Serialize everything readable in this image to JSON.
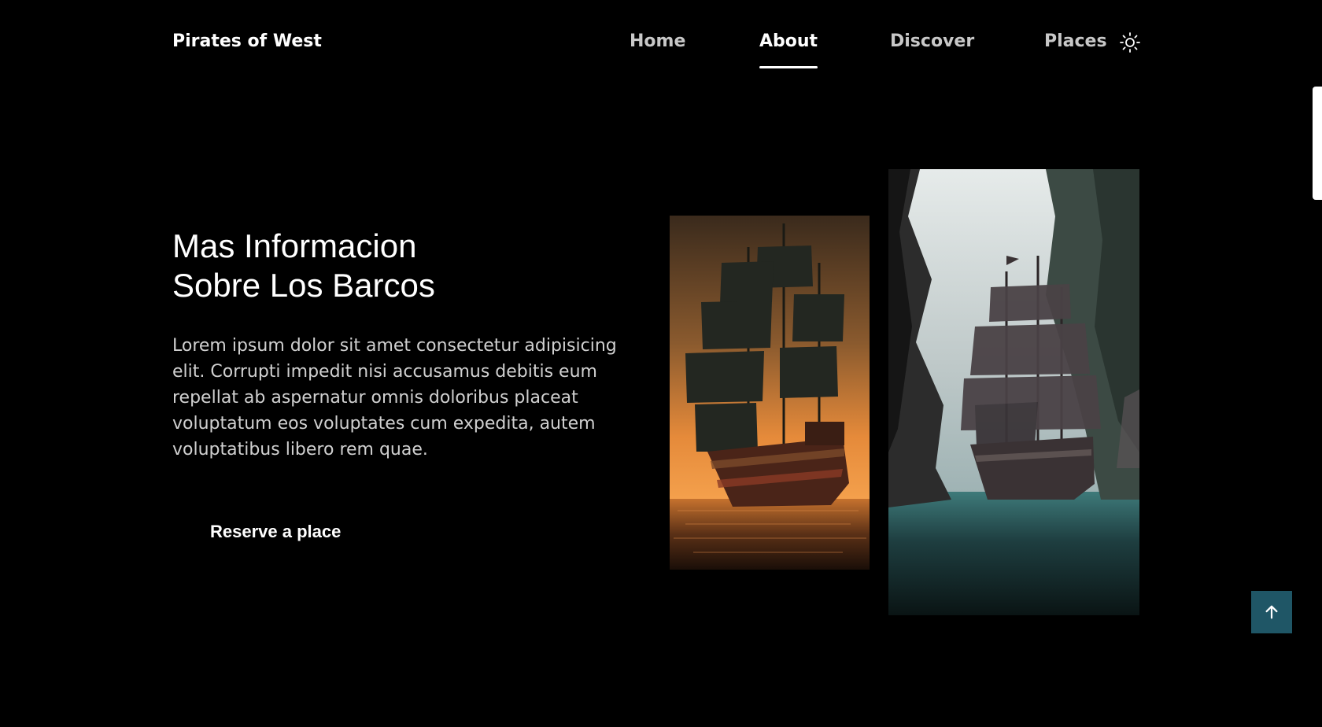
{
  "header": {
    "logo": "Pirates of West",
    "nav": [
      {
        "label": "Home",
        "active": false
      },
      {
        "label": "About",
        "active": true
      },
      {
        "label": "Discover",
        "active": false
      },
      {
        "label": "Places",
        "active": false
      }
    ],
    "theme_toggle_icon": "sun-icon"
  },
  "hero": {
    "title_line1": "Mas Informacion",
    "title_line2": "Sobre Los Barcos",
    "description": "Lorem ipsum dolor sit amet consectetur adipisicing elit. Corrupti impedit nisi accusamus debitis eum repellat ab aspernatur omnis doloribus placeat voluptatum eos voluptates cum expedita, autem voluptatibus libero rem quae.",
    "cta_label": "Reserve a place"
  },
  "images": [
    {
      "name": "pirate-ship-sunset-image"
    },
    {
      "name": "pirate-ship-cove-image"
    }
  ],
  "scroll_top_icon": "arrow-up-icon",
  "colors": {
    "background": "#000000",
    "text": "#ffffff",
    "nav_inactive": "#c8c8c8",
    "accent": "#1f5666"
  }
}
